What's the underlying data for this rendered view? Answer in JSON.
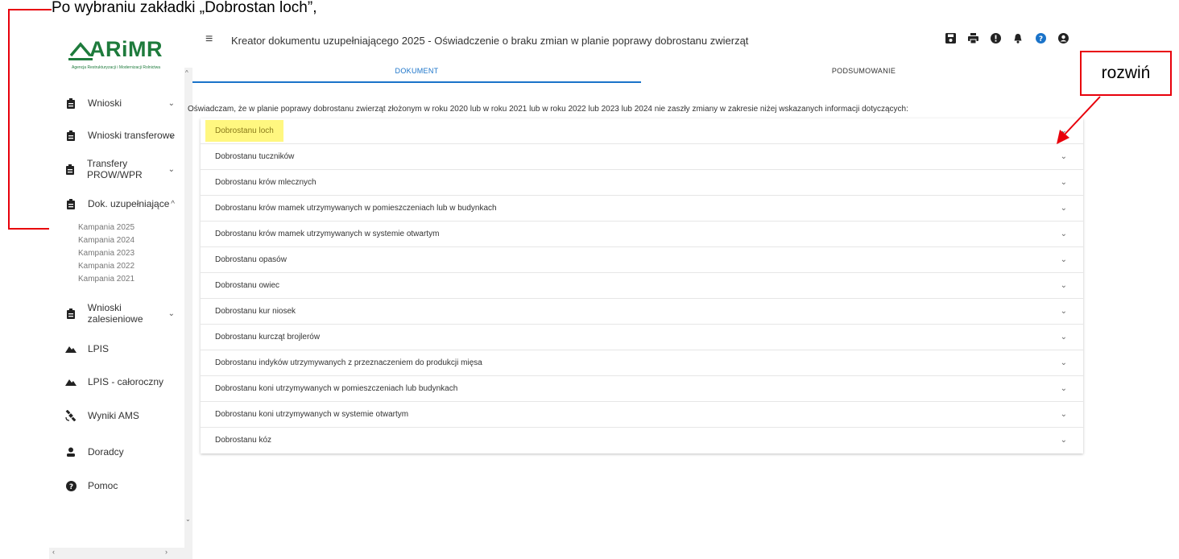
{
  "annotation": {
    "caption": "Po wybraniu zakładki „Dobrostan loch”,",
    "box_label": "rozwiń",
    "color": "#e8000b"
  },
  "logo": {
    "name": "ARiMR",
    "subtitle": "Agencja Restrukturyzacji i Modernizacji Rolnictwa"
  },
  "sidebar": {
    "items": [
      {
        "label": "Wnioski",
        "icon": "clipboard-icon",
        "chevron": "⌄"
      },
      {
        "label": "Wnioski transferowe",
        "icon": "clipboard-icon",
        "chevron": "⌄"
      },
      {
        "label": "Transfery PROW/WPR",
        "icon": "clipboard-icon",
        "chevron": "⌄"
      },
      {
        "label": "Dok. uzupełniające",
        "icon": "clipboard-icon",
        "chevron": "^"
      },
      {
        "label": "Wnioski zalesieniowe",
        "icon": "clipboard-icon",
        "chevron": "⌄"
      },
      {
        "label": "LPIS",
        "icon": "terrain-icon"
      },
      {
        "label": "LPIS - całoroczny",
        "icon": "terrain-icon"
      },
      {
        "label": "Wyniki AMS",
        "icon": "satellite-icon"
      },
      {
        "label": "Doradcy",
        "icon": "person-icon"
      },
      {
        "label": "Pomoc",
        "icon": "help-icon"
      }
    ],
    "sub_items": [
      "Kampania 2025",
      "Kampania 2024",
      "Kampania 2023",
      "Kampania 2022",
      "Kampania 2021"
    ]
  },
  "header": {
    "title": "Kreator dokumentu uzupełniającego 2025 - Oświadczenie o braku zmian w planie poprawy dobrostanu zwierząt",
    "tools": [
      "save-icon",
      "print-icon",
      "alert-icon",
      "bell-icon",
      "help-icon",
      "account-icon"
    ]
  },
  "tabs": [
    {
      "label": "DOKUMENT",
      "active": true
    },
    {
      "label": "PODSUMOWANIE",
      "active": false
    }
  ],
  "statement": "Oświadczam, że w planie poprawy dobrostanu zwierząt złożonym w roku 2020 lub w roku 2021 lub w roku 2022 lub 2023 lub 2024 nie zaszły zmiany w zakresie niżej wskazanych informacji dotyczących:",
  "accordion": [
    "Dobrostanu loch",
    "Dobrostanu tuczników",
    "Dobrostanu krów mlecznych",
    "Dobrostanu krów mamek utrzymywanych w pomieszczeniach lub w budynkach",
    "Dobrostanu krów mamek utrzymywanych w systemie otwartym",
    "Dobrostanu opasów",
    "Dobrostanu owiec",
    "Dobrostanu kur niosek",
    "Dobrostanu kurcząt brojlerów",
    "Dobrostanu indyków utrzymywanych z przeznaczeniem do produkcji mięsa",
    "Dobrostanu koni utrzymywanych w pomieszczeniach lub budynkach",
    "Dobrostanu koni utrzymywanych w systemie otwartym",
    "Dobrostanu kóz"
  ],
  "colors": {
    "brand": "#1e7b3c",
    "accent": "#1a73c9",
    "highlight": "#fff780"
  }
}
